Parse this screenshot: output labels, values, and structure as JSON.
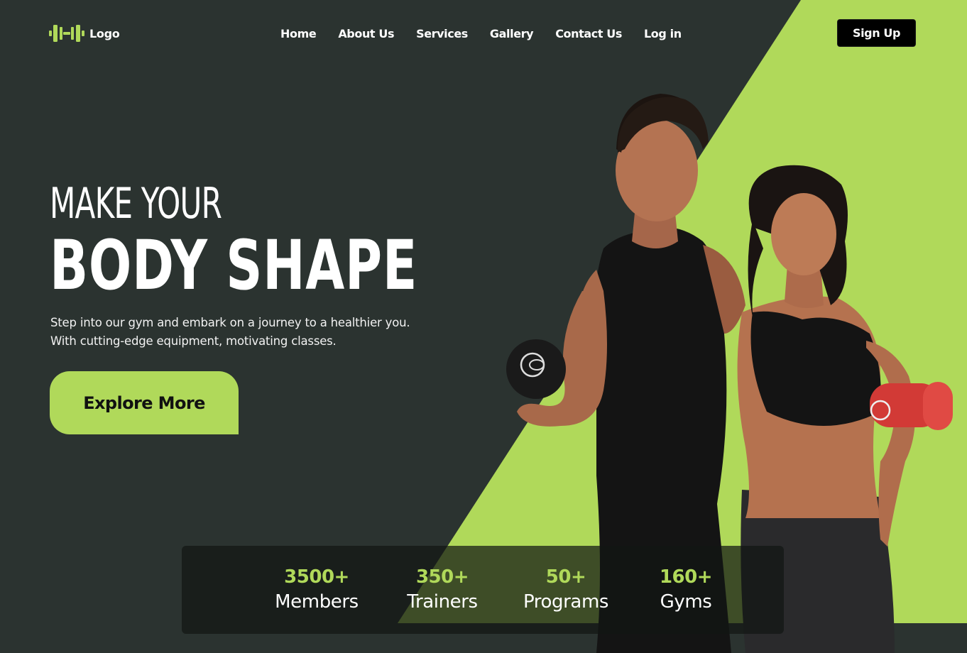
{
  "header": {
    "logo_text": "Logo",
    "nav": [
      "Home",
      "About Us",
      "Services",
      "Gallery",
      "Contact Us",
      "Log in"
    ],
    "signup_label": "Sign Up"
  },
  "hero": {
    "line1": "MAKE YOUR",
    "line2": "BODY SHAPE",
    "description": "Step into our gym and embark on a journey to a healthier you. With cutting-edge equipment, motivating classes.",
    "cta_label": "Explore More"
  },
  "stats": [
    {
      "number": "3500+",
      "label": "Members"
    },
    {
      "number": "350+",
      "label": "Trainers"
    },
    {
      "number": "50+",
      "label": "Programs"
    },
    {
      "number": "160+",
      "label": "Gyms"
    }
  ],
  "colors": {
    "background": "#2b3330",
    "accent": "#b0d95a",
    "button_dark": "#000000"
  },
  "icons": {
    "logo": "dumbbell-icon"
  }
}
